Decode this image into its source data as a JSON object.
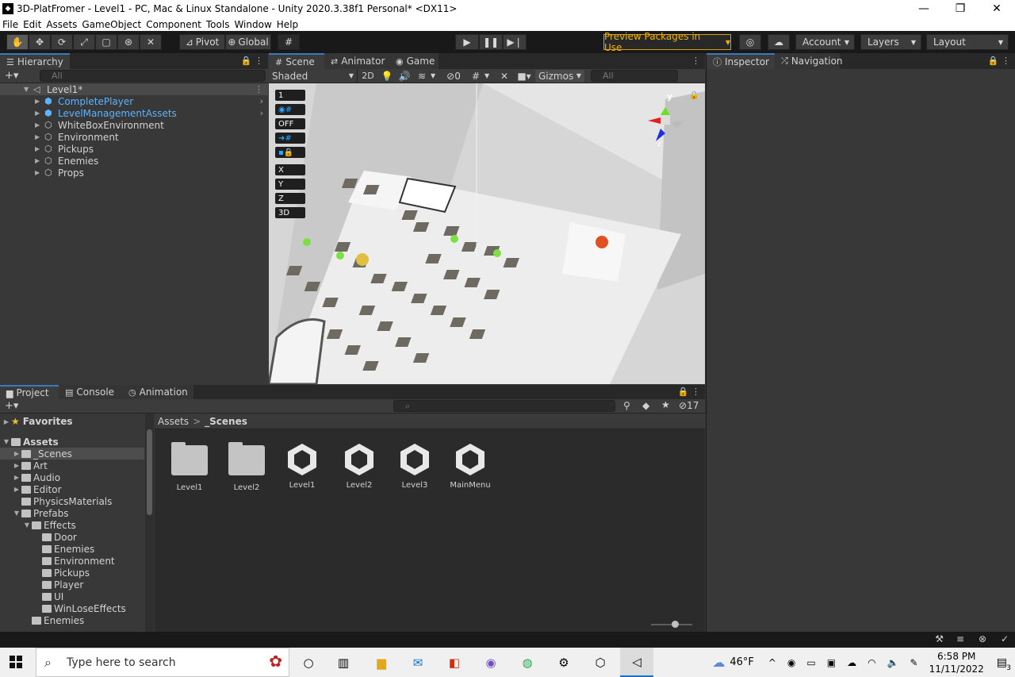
{
  "window": {
    "title": "3D-PlatFromer - Level1 - PC, Mac & Linux Standalone - Unity 2020.3.38f1 Personal* <DX11>",
    "minimize": "—",
    "restore": "❐",
    "close": "✕"
  },
  "menu": [
    "File",
    "Edit",
    "Assets",
    "GameObject",
    "Component",
    "Tools",
    "Window",
    "Help"
  ],
  "toolbar": {
    "tools": [
      "hand-tool",
      "move-tool",
      "rotate-tool",
      "scale-tool",
      "rect-tool",
      "transform-tool",
      "custom-tool"
    ],
    "pivot": "Pivot",
    "global": "Global",
    "preview_packages": "Preview Packages in Use",
    "account": "Account",
    "layers": "Layers",
    "layout": "Layout"
  },
  "hierarchy": {
    "tab": "Hierarchy",
    "search_placeholder": "All",
    "scene": "Level1*",
    "items": [
      {
        "label": "CompletePlayer",
        "prefab": true
      },
      {
        "label": "LevelManagementAssets",
        "prefab": true
      },
      {
        "label": "WhiteBoxEnvironment",
        "prefab": false
      },
      {
        "label": "Environment",
        "prefab": false
      },
      {
        "label": "Pickups",
        "prefab": false
      },
      {
        "label": "Enemies",
        "prefab": false
      },
      {
        "label": "Props",
        "prefab": false
      }
    ]
  },
  "scene_view": {
    "tabs": [
      "Scene",
      "Animator",
      "Game"
    ],
    "shading": "Shaded",
    "mode_2d": "2D",
    "hidden_count": "0",
    "gizmos": "Gizmos",
    "search_placeholder": "All",
    "overlay": [
      "1",
      "OFF",
      "X",
      "Y",
      "Z",
      "3D"
    ],
    "gizmo_axes": [
      "y",
      "z"
    ]
  },
  "inspector": {
    "tabs": [
      "Inspector",
      "Navigation"
    ]
  },
  "project": {
    "tabs": [
      "Project",
      "Console",
      "Animation"
    ],
    "badge_count": "17",
    "breadcrumb": [
      "Assets",
      "_Scenes"
    ],
    "breadcrumb_sep": ">",
    "favorites": "Favorites",
    "tree": [
      {
        "label": "Assets",
        "depth": 0,
        "open": true,
        "bold": true
      },
      {
        "label": "_Scenes",
        "depth": 1,
        "selected": true
      },
      {
        "label": "Art",
        "depth": 1
      },
      {
        "label": "Audio",
        "depth": 1
      },
      {
        "label": "Editor",
        "depth": 1
      },
      {
        "label": "PhysicsMaterials",
        "depth": 1,
        "noarrow": true
      },
      {
        "label": "Prefabs",
        "depth": 1,
        "open": true
      },
      {
        "label": "Effects",
        "depth": 2,
        "open": true
      },
      {
        "label": "Door",
        "depth": 3,
        "noarrow": true
      },
      {
        "label": "Enemies",
        "depth": 3,
        "noarrow": true
      },
      {
        "label": "Environment",
        "depth": 3,
        "noarrow": true
      },
      {
        "label": "Pickups",
        "depth": 3,
        "noarrow": true
      },
      {
        "label": "Player",
        "depth": 3,
        "noarrow": true
      },
      {
        "label": "UI",
        "depth": 3,
        "noarrow": true
      },
      {
        "label": "WinLoseEffects",
        "depth": 3,
        "noarrow": true
      },
      {
        "label": "Enemies",
        "depth": 2,
        "noarrow": true
      }
    ],
    "assets": [
      {
        "label": "Level1",
        "kind": "folder"
      },
      {
        "label": "Level2",
        "kind": "folder"
      },
      {
        "label": "Level1",
        "kind": "scene"
      },
      {
        "label": "Level2",
        "kind": "scene"
      },
      {
        "label": "Level3",
        "kind": "scene"
      },
      {
        "label": "MainMenu",
        "kind": "scene"
      }
    ]
  },
  "taskbar": {
    "search_placeholder": "Type here to search",
    "weather": "46°F",
    "time": "6:58 PM",
    "date": "11/11/2022",
    "notification_count": "3"
  },
  "colors": {
    "prefab_blue": "#5cb3ff",
    "accent": "#3a79bb",
    "preview_orange": "#f0b000"
  }
}
